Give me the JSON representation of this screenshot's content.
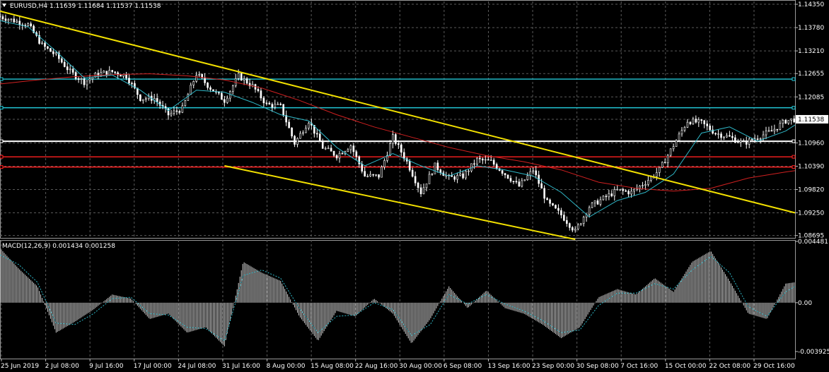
{
  "header": {
    "symbol_line": "EURUSD,H4  1.11639 1.11684 1.11537 1.11538",
    "indicator_label": "MACD(12,26,9) 0.001434 0.001258"
  },
  "colors": {
    "background": "#000000",
    "grid": "#5a5a5a",
    "candle": "#ffffff",
    "fast_ma": "#2fb7c7",
    "slow_ma": "#d02020",
    "trendline": "#f2e000",
    "cyan_level": "#22c7d6",
    "white_level": "#ffffff",
    "red_level": "#ff2020",
    "macd_hist": "#cfcfcf",
    "macd_signal": "#2fb7c7"
  },
  "chart_data": [
    {
      "type": "line",
      "title": "EURUSD,H4",
      "price_axis": [
        "1.14350",
        "1.13780",
        "1.13210",
        "1.12655",
        "1.12085",
        "1.11538",
        "1.10960",
        "1.10390",
        "1.09820",
        "1.09250",
        "1.08695"
      ],
      "current_price_label": "1.11538",
      "ylim": [
        1.0862,
        1.1442
      ],
      "time_axis": [
        "25 Jun 2019",
        "2 Jul 08:00",
        "9 Jul 16:00",
        "17 Jul 00:00",
        "24 Jul 08:00",
        "31 Jul 16:00",
        "8 Aug 00:00",
        "15 Aug 08:00",
        "22 Aug 16:00",
        "30 Aug 00:00",
        "6 Sep 08:00",
        "13 Sep 16:00",
        "23 Sep 00:00",
        "30 Sep 08:00",
        "7 Oct 16:00",
        "15 Oct 00:00",
        "22 Oct 08:00",
        "29 Oct 16:00"
      ],
      "series": [
        {
          "kind": "price",
          "x_index": [
            0,
            30,
            60,
            90,
            120,
            150,
            180,
            210,
            240,
            270,
            300,
            330,
            360,
            390,
            420,
            450,
            480,
            510,
            540,
            570,
            600,
            630,
            660,
            690,
            720,
            750,
            780,
            810,
            840,
            870,
            900,
            930,
            960,
            990,
            1020,
            1050,
            1080,
            1110,
            1140,
            1170,
            1200,
            1230,
            1260,
            1290,
            1320,
            1350,
            1380,
            1410,
            1440,
            1470,
            1500,
            1530,
            1560,
            1590,
            1620,
            1650,
            1680,
            1700
          ],
          "values": [
            1.1405,
            1.1395,
            1.1385,
            1.1335,
            1.131,
            1.127,
            1.1245,
            1.1265,
            1.127,
            1.126,
            1.1205,
            1.1205,
            1.1165,
            1.118,
            1.1265,
            1.123,
            1.12,
            1.126,
            1.1235,
            1.119,
            1.1185,
            1.1095,
            1.115,
            1.1085,
            1.1065,
            1.109,
            1.1015,
            1.1015,
            1.111,
            1.105,
            1.0975,
            1.104,
            1.101,
            1.1015,
            1.1055,
            1.105,
            1.102,
            1.099,
            1.103,
            1.095,
            1.092,
            1.088,
            1.094,
            1.096,
            1.098,
            1.0975,
            1.1,
            1.103,
            1.109,
            1.115,
            1.1145,
            1.112,
            1.111,
            1.1095,
            1.111,
            1.1125,
            1.115,
            1.1154
          ]
        },
        {
          "kind": "fast_ma",
          "x_index": [
            0,
            60,
            120,
            180,
            240,
            300,
            360,
            420,
            480,
            540,
            600,
            660,
            720,
            780,
            840,
            900,
            960,
            1020,
            1080,
            1140,
            1200,
            1260,
            1320,
            1380,
            1440,
            1500,
            1560,
            1620,
            1680,
            1700
          ],
          "values": [
            1.1395,
            1.138,
            1.132,
            1.1255,
            1.1262,
            1.1225,
            1.1175,
            1.1225,
            1.122,
            1.1195,
            1.1165,
            1.115,
            1.1085,
            1.104,
            1.107,
            1.104,
            1.1015,
            1.104,
            1.103,
            1.1015,
            1.0975,
            1.0915,
            1.0955,
            1.0975,
            1.102,
            1.112,
            1.1135,
            1.11,
            1.1125,
            1.114
          ]
        },
        {
          "kind": "slow_ma",
          "x_index": [
            0,
            80,
            160,
            240,
            320,
            400,
            480,
            560,
            640,
            720,
            800,
            880,
            960,
            1040,
            1120,
            1200,
            1280,
            1360,
            1440,
            1520,
            1600,
            1680,
            1700
          ],
          "values": [
            1.124,
            1.125,
            1.1258,
            1.1263,
            1.1265,
            1.126,
            1.125,
            1.123,
            1.12,
            1.1165,
            1.1135,
            1.111,
            1.1085,
            1.1065,
            1.105,
            1.103,
            1.1,
            1.0985,
            1.0978,
            1.0985,
            1.101,
            1.1025,
            1.1028
          ]
        }
      ],
      "trendlines": [
        {
          "name": "upper-trendline",
          "from": [
            0,
            1.1418
          ],
          "to": [
            1700,
            1.0925
          ]
        },
        {
          "name": "lower-trendline",
          "from": [
            480,
            1.104
          ],
          "to": [
            1230,
            1.086
          ]
        }
      ],
      "horizontal_levels": [
        {
          "name": "cyan-level-1",
          "price": 1.1252,
          "color": "#22c7d6"
        },
        {
          "name": "cyan-level-2",
          "price": 1.1182,
          "color": "#22c7d6"
        },
        {
          "name": "white-level",
          "price": 1.11,
          "color": "#ffffff"
        },
        {
          "name": "red-level-1",
          "price": 1.1062,
          "color": "#ff2020"
        },
        {
          "name": "red-level-2",
          "price": 1.1037,
          "color": "#ff2020"
        }
      ],
      "grid": true
    },
    {
      "type": "bar",
      "title": "MACD(12,26,9)",
      "ticks": [
        "0.004481",
        "0.00",
        "-0.003925"
      ],
      "ylim": [
        -0.0041,
        0.0046
      ],
      "histogram": {
        "x_index": [
          0,
          40,
          80,
          120,
          160,
          200,
          240,
          280,
          320,
          360,
          400,
          440,
          480,
          520,
          560,
          600,
          640,
          680,
          720,
          760,
          800,
          840,
          880,
          920,
          960,
          1000,
          1040,
          1080,
          1120,
          1160,
          1200,
          1240,
          1280,
          1320,
          1360,
          1400,
          1440,
          1480,
          1520,
          1560,
          1600,
          1640,
          1680,
          1700
        ],
        "values": [
          0.004,
          0.0025,
          0.0012,
          -0.0022,
          -0.0014,
          -0.0005,
          0.0006,
          0.0003,
          -0.0012,
          -0.0008,
          -0.0022,
          -0.0018,
          -0.0032,
          0.003,
          0.0022,
          0.0016,
          -0.001,
          -0.0028,
          -0.0006,
          -0.001,
          0.0003,
          -0.0008,
          -0.003,
          -0.0012,
          0.0012,
          -0.0004,
          0.0009,
          -0.0004,
          -0.0008,
          -0.0016,
          -0.0026,
          -0.0018,
          0.0004,
          0.001,
          0.0006,
          0.0018,
          0.0008,
          0.003,
          0.0038,
          0.0016,
          -0.0008,
          -0.0012,
          0.0014,
          0.0015
        ]
      },
      "signal": {
        "x_index": [
          0,
          40,
          80,
          120,
          160,
          200,
          240,
          280,
          320,
          360,
          400,
          440,
          480,
          520,
          560,
          600,
          640,
          680,
          720,
          760,
          800,
          840,
          880,
          920,
          960,
          1000,
          1040,
          1080,
          1120,
          1160,
          1200,
          1240,
          1280,
          1320,
          1360,
          1400,
          1440,
          1480,
          1520,
          1560,
          1600,
          1640,
          1680,
          1700
        ],
        "values": [
          0.0035,
          0.0028,
          0.0015,
          -0.0015,
          -0.0016,
          -0.0008,
          0.0003,
          0.0004,
          -0.0008,
          -0.0009,
          -0.0018,
          -0.0019,
          -0.0028,
          0.002,
          0.0024,
          0.0018,
          -0.0004,
          -0.0022,
          -0.001,
          -0.0009,
          0.0,
          -0.0005,
          -0.0024,
          -0.0016,
          0.0006,
          -0.0001,
          0.0006,
          -0.0001,
          -0.0006,
          -0.0013,
          -0.0022,
          -0.002,
          -0.0002,
          0.0007,
          0.0007,
          0.0014,
          0.001,
          0.0024,
          0.0034,
          0.0022,
          -0.0003,
          -0.001,
          0.0008,
          0.0012
        ]
      }
    }
  ]
}
